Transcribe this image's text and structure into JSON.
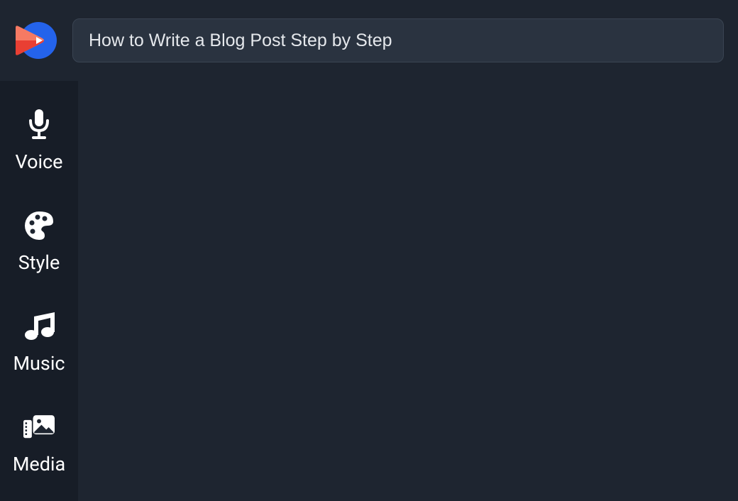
{
  "header": {
    "title_value": "How to Write a Blog Post Step by Step"
  },
  "sidebar": {
    "items": [
      {
        "icon": "microphone-icon",
        "label": "Voice"
      },
      {
        "icon": "palette-icon",
        "label": "Style"
      },
      {
        "icon": "music-icon",
        "label": "Music"
      },
      {
        "icon": "media-icon",
        "label": "Media"
      }
    ]
  },
  "colors": {
    "logo_blue": "#2463eb",
    "logo_red_light": "#f67a63",
    "logo_red_dark": "#e93f33",
    "bg_main": "#1e2530",
    "bg_sidebar": "#171d27",
    "input_bg": "#2a3340"
  }
}
